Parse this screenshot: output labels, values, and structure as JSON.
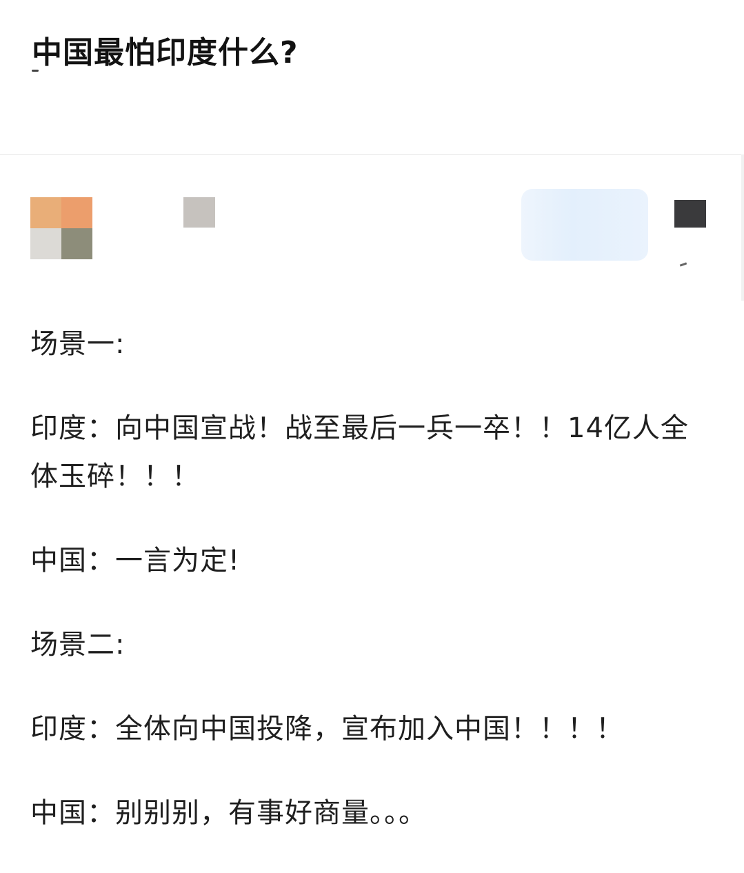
{
  "question": {
    "title": "中国最怕印度什么?"
  },
  "author": {
    "avatar_colors": [
      "#e9ae78",
      "#ec9e6c",
      "#dcdad6",
      "#8d8d7a"
    ],
    "badge_color": "#c6c2be",
    "follow_button_color": "#e3effc",
    "more_button_color": "#3a3a3c"
  },
  "answer": {
    "paragraphs": [
      "场景一:",
      "印度：向中国宣战！战至最后一兵一卒！！14亿人全体玉碎！！！",
      "中国：一言为定!",
      "场景二:",
      "印度：全体向中国投降，宣布加入中国！！！！",
      "中国：别别别，有事好商量。。。"
    ]
  }
}
